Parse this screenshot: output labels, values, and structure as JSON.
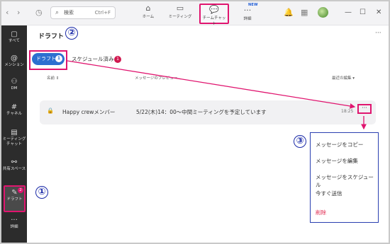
{
  "topbar": {
    "search_placeholder": "検索",
    "search_shortcut": "Ctrl+F",
    "nav": [
      {
        "label": "ホーム",
        "icon": "home-icon"
      },
      {
        "label": "ミーティング",
        "icon": "video-icon"
      },
      {
        "label": "チームチャット",
        "icon": "chat-icon"
      },
      {
        "label": "詳細",
        "icon": "more-icon"
      }
    ],
    "new_badge": "NEW"
  },
  "sidebar": {
    "items": [
      {
        "label": "すべて",
        "icon": "chat-bubble-icon"
      },
      {
        "label": "メンション",
        "icon": "at-icon"
      },
      {
        "label": "DM",
        "icon": "people-icon"
      },
      {
        "label": "チャネル",
        "icon": "hash-icon"
      },
      {
        "label": "ミーティング チャット",
        "icon": "calendar-icon"
      },
      {
        "label": "共有スペース",
        "icon": "share-icon"
      },
      {
        "label": "ドラフト",
        "icon": "draft-icon",
        "badge": "2"
      },
      {
        "label": "詳細",
        "icon": "ellipsis-icon"
      }
    ]
  },
  "main": {
    "title": "ドラフト",
    "tabs": [
      {
        "label": "ドラフト",
        "count": "1"
      },
      {
        "label": "スケジュール済み",
        "count": "1"
      }
    ],
    "columns": {
      "name": "名前 ⇕",
      "preview": "メッセージのプレビュー",
      "recent": "最近の編集 ▾"
    },
    "row": {
      "name": "Happy crewメンバー",
      "preview": "5/22(木)14：00〜中間ミーティングを予定しています",
      "time": "18:25",
      "more": "···"
    }
  },
  "context_menu": {
    "items": [
      "メッセージをコピー",
      "メッセージを編集",
      "メッセージをスケジュール",
      "今すぐ送信",
      "削除"
    ]
  },
  "annotations": {
    "step1": "①",
    "step2": "②",
    "step3": "③"
  },
  "colors": {
    "accent": "#e0156f",
    "primary": "#2d6fd0",
    "annotation": "#1a2aa8"
  }
}
